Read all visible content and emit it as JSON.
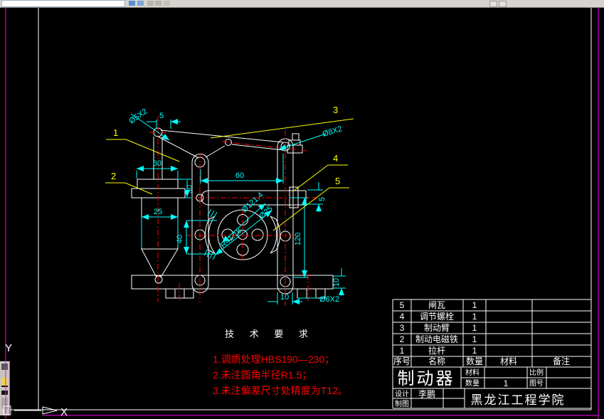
{
  "toolbar": {
    "note": "partial toolbar strip"
  },
  "drawing": {
    "balloons": [
      "1",
      "2",
      "3",
      "4",
      "5"
    ],
    "dimensions": {
      "top_pin_width": "5",
      "pin_top_left": "Ø5X2",
      "flange_width": "60",
      "plate_thickness": "30",
      "body_width": "25",
      "arm_span": "60",
      "shoe_height": "40",
      "arm_height": "120",
      "rod_thickness": "5",
      "pin_top_right": "Ø8X2",
      "wheel_dia": "Ø121.4",
      "hub_dia": "Ø25",
      "shoe_radius": "R41.18",
      "base_height": "10",
      "foot_width": "10",
      "foot_holes": "Ø6X2"
    },
    "axis": {
      "x_label": "X",
      "y_label": "Y"
    }
  },
  "tech_requirements": {
    "title": "技 术 要 求",
    "items": [
      "1.调质处理HBS190—230；",
      "2.未注圆角半径R1.5；",
      "3.未注偏差尺寸处精度为T12。"
    ]
  },
  "title_block": {
    "parts": [
      {
        "seq": "5",
        "name": "闸瓦",
        "qty": "1",
        "material": "",
        "note": ""
      },
      {
        "seq": "4",
        "name": "调节螺栓",
        "qty": "1",
        "material": "",
        "note": ""
      },
      {
        "seq": "3",
        "name": "制动臂",
        "qty": "1",
        "material": "",
        "note": ""
      },
      {
        "seq": "2",
        "name": "制动电磁铁",
        "qty": "1",
        "material": "",
        "note": ""
      },
      {
        "seq": "1",
        "name": "拉杆",
        "qty": "1",
        "material": "",
        "note": ""
      }
    ],
    "headers": {
      "seq": "序号",
      "name": "名称",
      "qty": "数量",
      "material": "材料",
      "note": "备注"
    },
    "title": "制动器",
    "fields": {
      "material_label": "材料",
      "material_value": "",
      "qty_label": "数量",
      "qty_value": "1",
      "scale_label": "比例",
      "scale_value": "",
      "drawing_no_label": "图号",
      "drawing_no_value": ""
    },
    "signatures": {
      "design_label": "设计",
      "design_name": "李鹏",
      "draw_label": "制图"
    },
    "school": "黑龙江工程学院"
  }
}
